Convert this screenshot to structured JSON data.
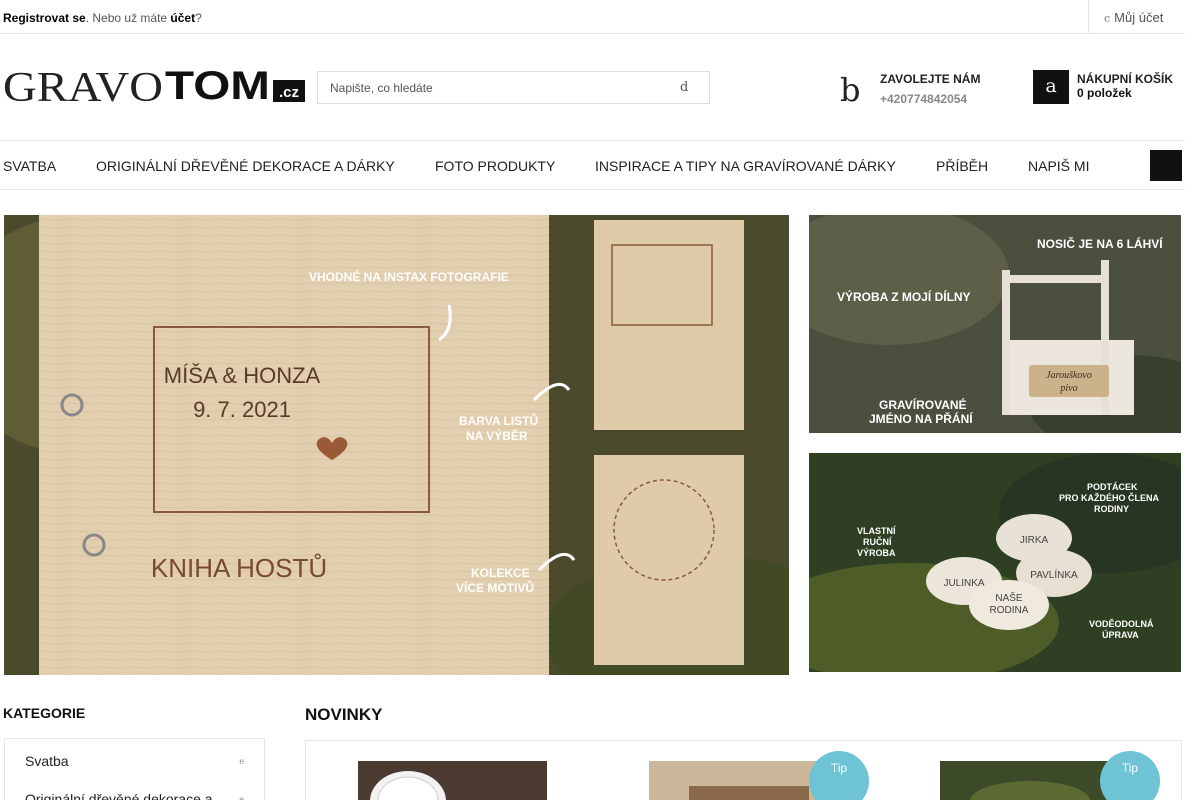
{
  "topbar": {
    "register_label": "Registrovat se",
    "middle_text": ". Nebo už máte ",
    "account_link": "účet",
    "end_text": "?",
    "my_account_icon": "c",
    "my_account_label": "Můj účet"
  },
  "header": {
    "logo": {
      "part1": "GRAVO",
      "part2": "TOM",
      "part3": ".cz"
    },
    "search_placeholder": "Napište, co hledáte",
    "search_icon": "d",
    "contact_icon": "b",
    "contact_title": "ZAVOLEJTE NÁM",
    "contact_phone": "+420774842054",
    "cart_icon": "a",
    "cart_title": "NÁKUPNÍ KOŠÍK",
    "cart_count": "0 položek"
  },
  "nav": {
    "items": [
      {
        "label": "SVATBA"
      },
      {
        "label": "ORIGINÁLNÍ DŘEVĚNÉ DEKORACE A DÁRKY"
      },
      {
        "label": "FOTO PRODUKTY"
      },
      {
        "label": "INSPIRACE A TIPY NA GRAVÍROVANÉ DÁRKY"
      },
      {
        "label": "PŘÍBĚH"
      },
      {
        "label": "NAPIŠ MI"
      }
    ],
    "menu_icon": ""
  },
  "slider": {
    "prev_icon": "",
    "next_icon": "",
    "captions": [
      "VHODNÉ NA INSTAX FOTOGRAFIE",
      "BARVA LISTŮ",
      "NA VÝBĚR",
      "KOLEKCE",
      "VÍCE MOTIVŮ"
    ],
    "book": {
      "names": "MÍŠA & HONZA",
      "date": "9. 7. 2021",
      "title": "KNIHA HOSTŮ"
    }
  },
  "banner1": {
    "captions": [
      "NOSIČ JE NA 6 LÁHVÍ",
      "VÝROBA Z MOJÍ DÍLNY",
      "GRAVÍROVANÉ",
      "JMÉNO NA PŘÁNÍ"
    ],
    "plaque_line1": "Jarouškovo",
    "plaque_line2": "pivo"
  },
  "banner2": {
    "captions": [
      "PODTÁCEK",
      "PRO KAŽDÉHO ČLENA",
      "RODINY",
      "VLASTNÍ",
      "RUČNÍ",
      "VÝROBA",
      "VODĚODOLNÁ",
      "ÚPRAVA"
    ],
    "coasters": [
      "JIRKA",
      "JULINKA",
      "PAVLÍNKA",
      "NAŠE",
      "RODINA"
    ]
  },
  "sidebar": {
    "title": "KATEGORIE",
    "items": [
      {
        "label": "Svatba",
        "arrow": "e"
      },
      {
        "label": "Originální dřevěné dekorace a",
        "arrow": "e"
      }
    ]
  },
  "novinky": {
    "title": "NOVINKY",
    "tip_label": "Tip"
  },
  "colors": {
    "accent_dark": "#111111",
    "tip_badge": "#6ec3d4",
    "border": "#e6e6e6"
  }
}
